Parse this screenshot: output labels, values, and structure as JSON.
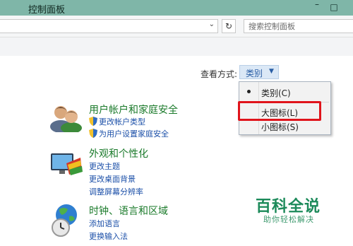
{
  "window": {
    "title": "控制面板",
    "maximize_glyph": "□",
    "minimize_glyph": "–"
  },
  "address": {
    "chevron": "⌄",
    "refresh": "↻"
  },
  "search": {
    "placeholder": "搜索控制面板"
  },
  "view_by": {
    "label": "查看方式:",
    "selected": "类别",
    "arrow": "▼",
    "options": [
      "类别(C)",
      "大图标(L)",
      "小图标(S)"
    ]
  },
  "categories": [
    {
      "title": "用户帐户和家庭安全",
      "links": [
        "更改帐户类型",
        "为用户设置家庭安全"
      ]
    },
    {
      "title": "外观和个性化",
      "links": [
        "更改主题",
        "更改桌面背景",
        "调整屏幕分辨率"
      ]
    },
    {
      "title": "时钟、语言和区域",
      "links": [
        "添加语言",
        "更换输入法"
      ]
    }
  ],
  "watermark": {
    "title": "百科全说",
    "subtitle": "助你轻松解决"
  },
  "colors": {
    "accent_green": "#1a7a2a",
    "link_blue": "#1b4fa8",
    "highlight_red": "#e0141b",
    "titlebar": "#7fb6a8"
  }
}
